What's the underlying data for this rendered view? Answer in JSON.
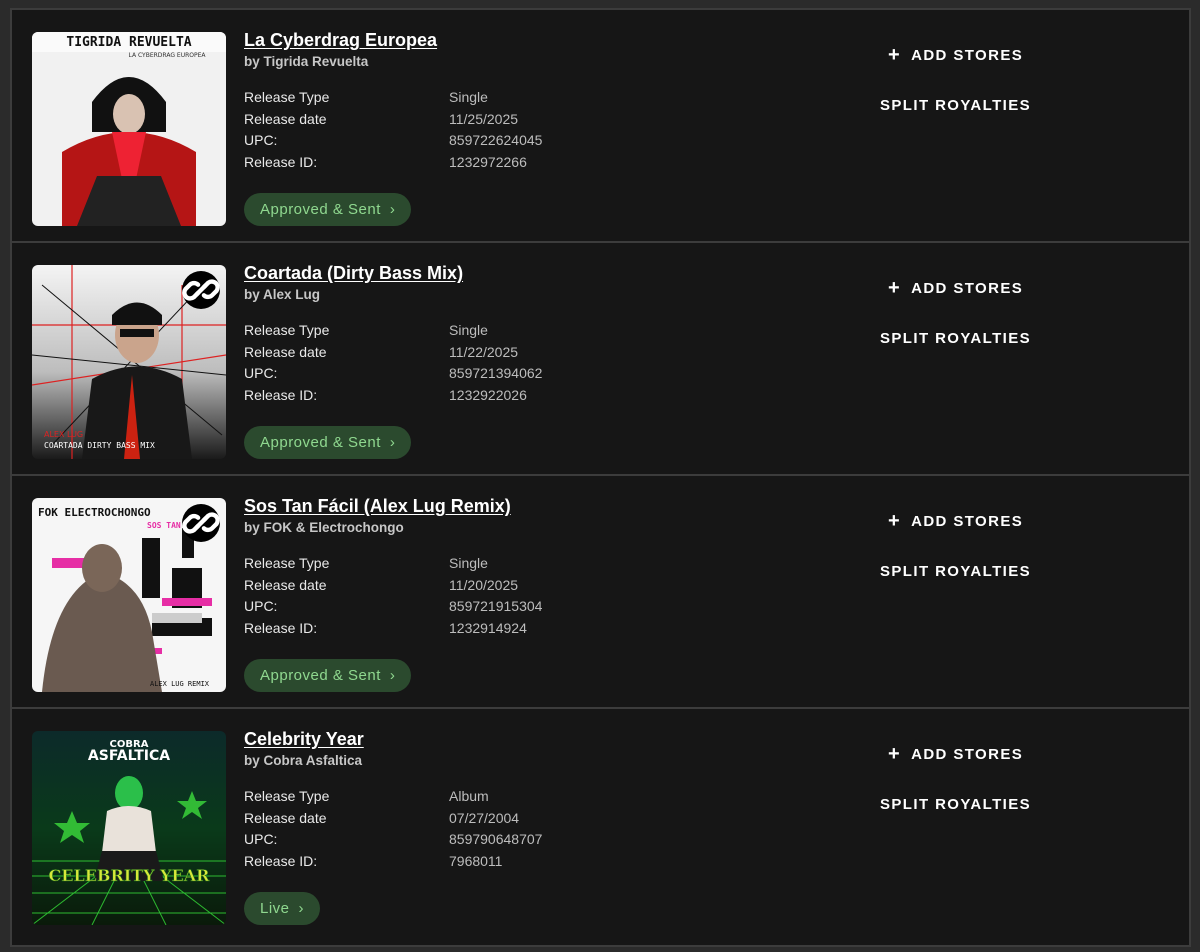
{
  "labels": {
    "release_type": "Release Type",
    "release_date": "Release date",
    "upc": "UPC:",
    "release_id": "Release ID:",
    "add_stores": "ADD STORES",
    "split_royalties": "SPLIT ROYALTIES",
    "chevron": "›",
    "plus": "+"
  },
  "releases": [
    {
      "title": "La Cyberdrag Europea",
      "artist": "by Tigrida Revuelta",
      "release_type": "Single",
      "release_date": "11/25/2025",
      "upc": "859722624045",
      "release_id": "1232972266",
      "status": "Approved & Sent",
      "cover_text_top": "TIGRIDA REVUELTA",
      "cover_text_sub": "LA CYBERDRAG EUROPEA"
    },
    {
      "title": "Coartada (Dirty Bass Mix)",
      "artist": "by Alex Lug",
      "release_type": "Single",
      "release_date": "11/22/2025",
      "upc": "859721394062",
      "release_id": "1232922026",
      "status": "Approved & Sent",
      "cover_text_top": "ALEX LUG",
      "cover_text_sub": "COARTADA DIRTY BASS MIX"
    },
    {
      "title": "Sos Tan Fácil (Alex Lug Remix)",
      "artist": "by FOK & Electrochongo",
      "release_type": "Single",
      "release_date": "11/20/2025",
      "upc": "859721915304",
      "release_id": "1232914924",
      "status": "Approved & Sent",
      "cover_text_top": "FOK ELECTROCHONGO",
      "cover_text_sub": "SOS TAN",
      "cover_text_bottom": "ALEX LUG REMIX"
    },
    {
      "title": "Celebrity Year",
      "artist": "by Cobra Asfaltica",
      "release_type": "Album",
      "release_date": "07/27/2004",
      "upc": "859790648707",
      "release_id": "7968011",
      "status": "Live",
      "cover_text_top": "COBRA",
      "cover_text_sub": "ASFALTICA",
      "cover_text_bottom": "CELEBRITY YEAR"
    }
  ],
  "colors": {
    "background": "#161616",
    "status_bg": "#2b4a2e",
    "status_text": "#8fd88f",
    "border": "#3c3c3c"
  },
  "icons": {
    "link": "link-icon",
    "plus": "plus-icon",
    "chevron": "chevron-right-icon"
  }
}
